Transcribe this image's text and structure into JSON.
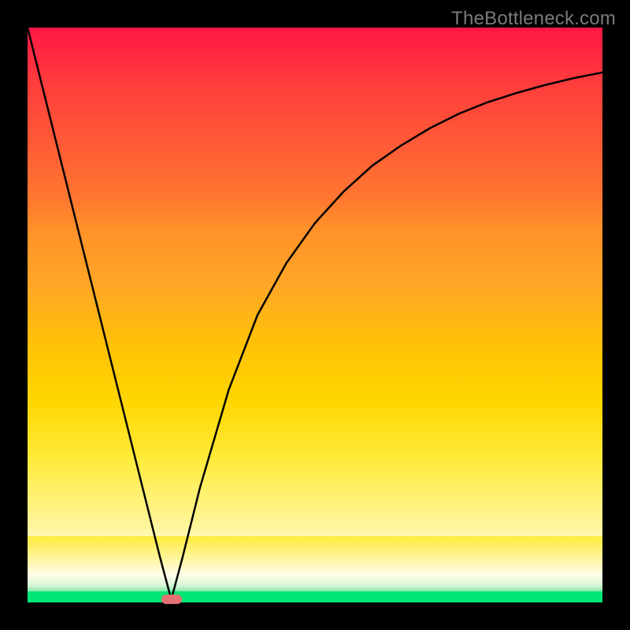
{
  "watermark": "TheBottleneck.com",
  "chart_data": {
    "type": "line",
    "title": "",
    "xlabel": "",
    "ylabel": "",
    "xlim": [
      0,
      100
    ],
    "ylim": [
      0,
      100
    ],
    "grid": false,
    "legend": false,
    "background_gradient": {
      "stops": [
        {
          "pos": 0.0,
          "color": "#ff1744"
        },
        {
          "pos": 0.35,
          "color": "#ff9129"
        },
        {
          "pos": 0.65,
          "color": "#ffd600"
        },
        {
          "pos": 0.92,
          "color": "#fffde7"
        },
        {
          "pos": 1.0,
          "color": "#00e676"
        }
      ]
    },
    "curve_points": [
      {
        "x": 0.0,
        "y": 100.0
      },
      {
        "x": 5.0,
        "y": 80.0
      },
      {
        "x": 10.0,
        "y": 60.0
      },
      {
        "x": 15.0,
        "y": 40.0
      },
      {
        "x": 20.0,
        "y": 20.0
      },
      {
        "x": 23.0,
        "y": 8.0
      },
      {
        "x": 25.0,
        "y": 0.5
      },
      {
        "x": 27.0,
        "y": 8.0
      },
      {
        "x": 30.0,
        "y": 20.0
      },
      {
        "x": 35.0,
        "y": 37.0
      },
      {
        "x": 40.0,
        "y": 50.0
      },
      {
        "x": 45.0,
        "y": 59.0
      },
      {
        "x": 50.0,
        "y": 66.0
      },
      {
        "x": 55.0,
        "y": 71.5
      },
      {
        "x": 60.0,
        "y": 76.0
      },
      {
        "x": 65.0,
        "y": 79.5
      },
      {
        "x": 70.0,
        "y": 82.5
      },
      {
        "x": 75.0,
        "y": 85.0
      },
      {
        "x": 80.0,
        "y": 87.0
      },
      {
        "x": 85.0,
        "y": 88.6
      },
      {
        "x": 90.0,
        "y": 90.0
      },
      {
        "x": 95.0,
        "y": 91.2
      },
      {
        "x": 100.0,
        "y": 92.2
      }
    ],
    "marker": {
      "x": 25.0,
      "y": 0.5,
      "color": "#e57373"
    }
  }
}
